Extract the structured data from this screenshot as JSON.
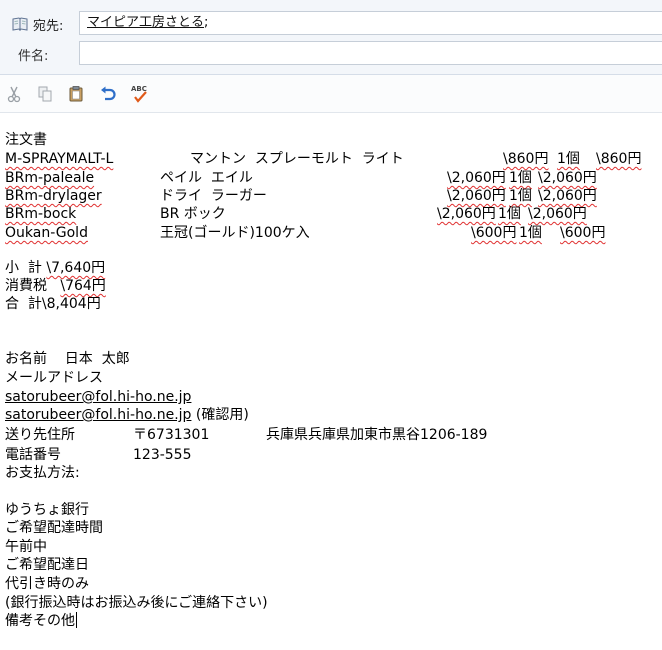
{
  "header": {
    "to_button_label": "宛先:",
    "to_recipient": "マイピア工房さとる",
    "to_separator": ";",
    "subject_label": "件名:",
    "subject_value": ""
  },
  "toolbar": {
    "icons": [
      "cut-icon",
      "copy-icon",
      "paste-icon",
      "undo-icon",
      "spellcheck-icon"
    ],
    "spellcheck_text": "ABC"
  },
  "body": {
    "title": "注文書",
    "items": [
      {
        "code": "M-SPRAYMALT-L",
        "name": "マントン  スプレーモルト  ライト",
        "price": "\\860円",
        "qty": "1個",
        "total": "\\860円"
      },
      {
        "code": "BRm-paleale",
        "name": "ペイル  エイル",
        "price": "\\2,060円",
        "qty": "1個",
        "total": "\\2,060円"
      },
      {
        "code": "BRm-drylager",
        "name": "ドライ  ラーガー",
        "price": "\\2,060円",
        "qty": "1個",
        "total": "\\2,060円"
      },
      {
        "code": "BRm-bock",
        "name": "BR ボック",
        "price": "\\2,060円",
        "qty": "1個",
        "total": "\\2,060円"
      },
      {
        "code": "Oukan-Gold",
        "name": "王冠(ゴールド)100ケ入",
        "price": "\\600円",
        "qty": "1個",
        "total": "\\600円"
      }
    ],
    "subtotal_label": "小  計",
    "subtotal_value": "\\7,640円",
    "tax_label": "消費税",
    "tax_value": "\\764円",
    "total_label": "合  計",
    "total_value": "\\8,404円",
    "name_line": "お名前    日本  太郎",
    "email_label": "メールアドレス",
    "email": "satorubeer@fol.hi-ho.ne.jp",
    "email_confirm": "satorubeer@fol.hi-ho.ne.jp",
    "email_confirm_note": "(確認用)",
    "address_label": "送り先住所",
    "postal": "〒6731301",
    "address": "兵庫県兵庫県加東市黒谷1206-189",
    "phone_label": "電話番号",
    "phone": "123-555",
    "payment_label": "お支払方法:",
    "payment": "ゆうちょ銀行",
    "time_label": "ご希望配達時間",
    "time": "午前中",
    "date_label": "ご希望配達日",
    "date": "代引き時のみ",
    "note": "(銀行振込時はお振込み後にご連絡下さい)",
    "remarks": "備考その他"
  }
}
